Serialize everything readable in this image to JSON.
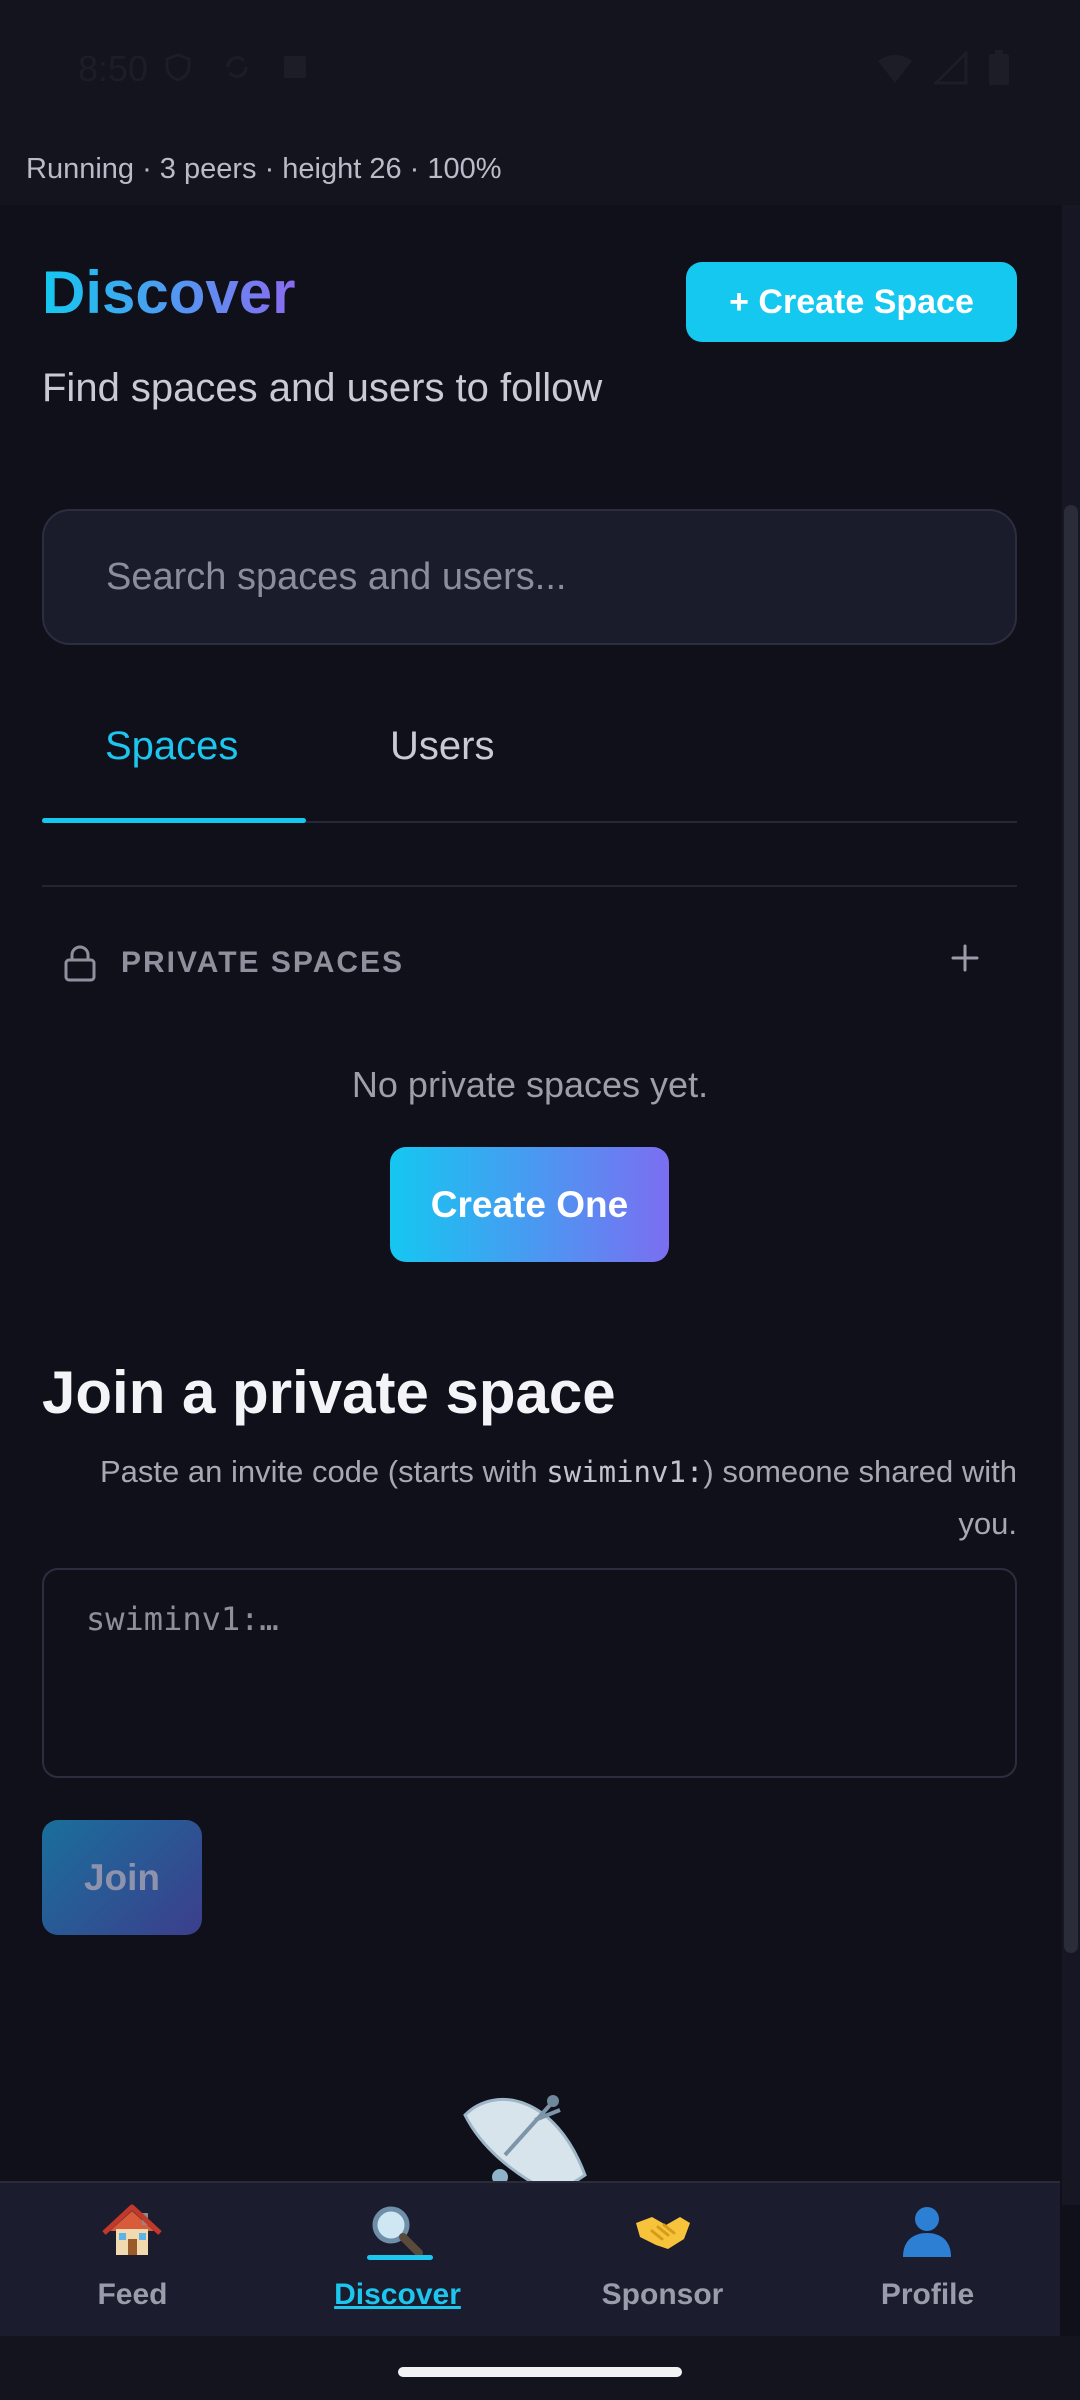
{
  "status_bar": {
    "time": "8:50"
  },
  "node_status": "Running · 3 peers · height 26 · 100%",
  "header": {
    "title": "Discover",
    "subtitle": "Find spaces and users to follow",
    "create_space_label": "+ Create Space"
  },
  "search": {
    "placeholder": "Search spaces and users..."
  },
  "tabs": [
    {
      "label": "Spaces",
      "active": true
    },
    {
      "label": "Users",
      "active": false
    }
  ],
  "private_spaces": {
    "label": "PRIVATE SPACES",
    "empty_text": "No private spaces yet.",
    "create_one_label": "Create One"
  },
  "join": {
    "heading": "Join a private space",
    "help_before": "Paste an invite code (starts with ",
    "help_code": "swiminv1:",
    "help_after": ") someone shared with you.",
    "input_placeholder": "swiminv1:…",
    "button_label": "Join"
  },
  "nav": {
    "items": [
      {
        "label": "Feed",
        "icon": "house-icon"
      },
      {
        "label": "Discover",
        "icon": "magnifier-icon",
        "active": true
      },
      {
        "label": "Sponsor",
        "icon": "handshake-icon"
      },
      {
        "label": "Profile",
        "icon": "person-icon"
      }
    ]
  },
  "colors": {
    "accent": "#14c8f0",
    "accent_purple": "#7b6ef1",
    "background": "#0f1019",
    "nav_background": "#1b1c2e"
  }
}
